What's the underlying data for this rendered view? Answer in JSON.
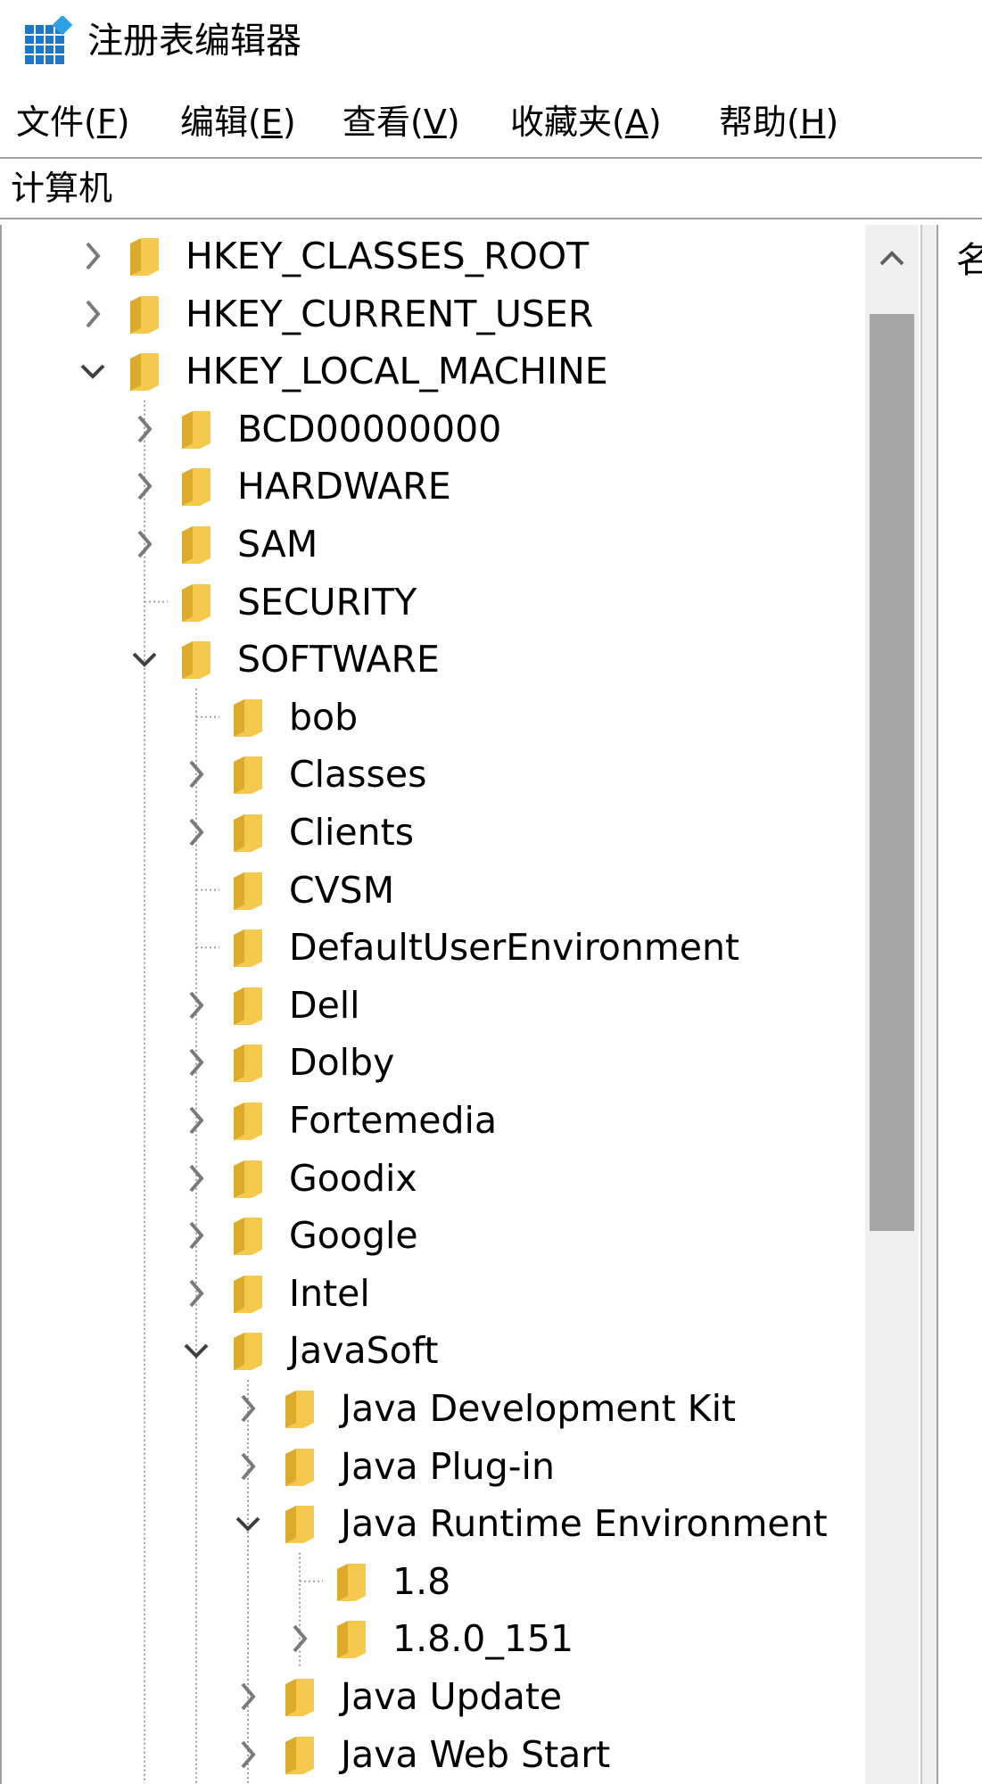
{
  "window": {
    "title": "注册表编辑器",
    "icon": "registry-editor-icon"
  },
  "menu": [
    {
      "pre": "文件(",
      "acc": "F",
      "post": ")"
    },
    {
      "pre": "编辑(",
      "acc": "E",
      "post": ")"
    },
    {
      "pre": "查看(",
      "acc": "V",
      "post": ")"
    },
    {
      "pre": "收藏夹(",
      "acc": "A",
      "post": ")"
    },
    {
      "pre": "帮助(",
      "acc": "H",
      "post": ")"
    }
  ],
  "address": {
    "path": "计算机"
  },
  "tree": [
    {
      "label": "HKEY_CLASSES_ROOT",
      "depth": 0,
      "state": "collapsed"
    },
    {
      "label": "HKEY_CURRENT_USER",
      "depth": 0,
      "state": "collapsed"
    },
    {
      "label": "HKEY_LOCAL_MACHINE",
      "depth": 0,
      "state": "expanded"
    },
    {
      "label": "BCD00000000",
      "depth": 1,
      "state": "collapsed"
    },
    {
      "label": "HARDWARE",
      "depth": 1,
      "state": "collapsed"
    },
    {
      "label": "SAM",
      "depth": 1,
      "state": "collapsed"
    },
    {
      "label": "SECURITY",
      "depth": 1,
      "state": "leaf"
    },
    {
      "label": "SOFTWARE",
      "depth": 1,
      "state": "expanded"
    },
    {
      "label": "bob",
      "depth": 2,
      "state": "leaf"
    },
    {
      "label": "Classes",
      "depth": 2,
      "state": "collapsed"
    },
    {
      "label": "Clients",
      "depth": 2,
      "state": "collapsed"
    },
    {
      "label": "CVSM",
      "depth": 2,
      "state": "leaf"
    },
    {
      "label": "DefaultUserEnvironment",
      "depth": 2,
      "state": "leaf"
    },
    {
      "label": "Dell",
      "depth": 2,
      "state": "collapsed"
    },
    {
      "label": "Dolby",
      "depth": 2,
      "state": "collapsed"
    },
    {
      "label": "Fortemedia",
      "depth": 2,
      "state": "collapsed"
    },
    {
      "label": "Goodix",
      "depth": 2,
      "state": "collapsed"
    },
    {
      "label": "Google",
      "depth": 2,
      "state": "collapsed"
    },
    {
      "label": "Intel",
      "depth": 2,
      "state": "collapsed"
    },
    {
      "label": "JavaSoft",
      "depth": 2,
      "state": "expanded"
    },
    {
      "label": "Java Development Kit",
      "depth": 3,
      "state": "collapsed"
    },
    {
      "label": "Java Plug-in",
      "depth": 3,
      "state": "collapsed"
    },
    {
      "label": "Java Runtime Environment",
      "depth": 3,
      "state": "expanded"
    },
    {
      "label": "1.8",
      "depth": 4,
      "state": "leaf"
    },
    {
      "label": "1.8.0_151",
      "depth": 4,
      "state": "collapsed"
    },
    {
      "label": "Java Update",
      "depth": 3,
      "state": "collapsed"
    },
    {
      "label": "Java Web Start",
      "depth": 3,
      "state": "collapsed"
    }
  ],
  "right_pane": {
    "column_header": "名"
  },
  "colors": {
    "folder": "#f4c94e",
    "folder_dark": "#dcab2c",
    "tree_line": "#a0a0a0",
    "chevron": "#7a7a7a",
    "scroll_thumb": "#a5a5a5"
  }
}
